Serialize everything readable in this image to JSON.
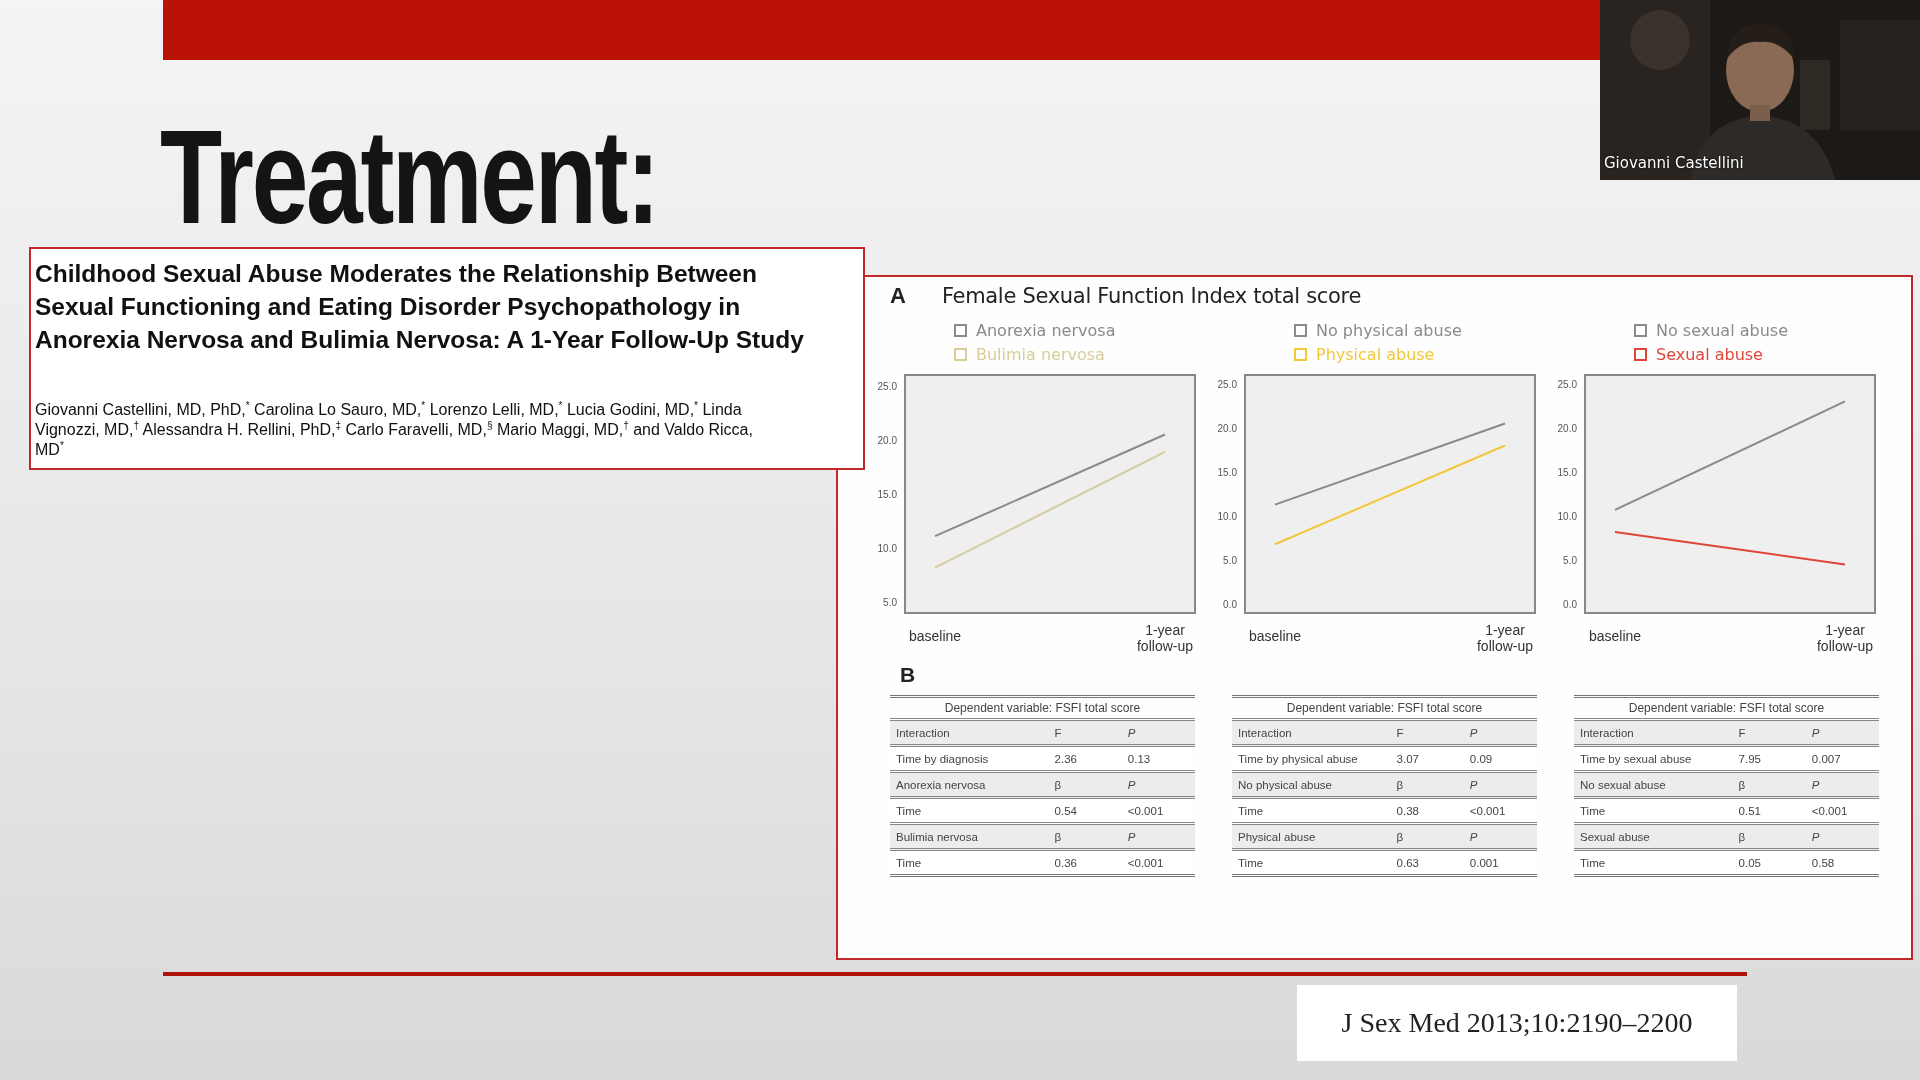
{
  "slide": {
    "title": "Treatment:"
  },
  "paper": {
    "title": "Childhood Sexual Abuse Moderates the Relationship Between Sexual Functioning and Eating Disorder Psychopathology in Anorexia Nervosa and Bulimia Nervosa: A 1-Year Follow-Up Study",
    "authors": "Giovanni Castellini, MD, PhD,$^{*}$ Carolina Lo Sauro, MD,$^{*}$ Lorenzo Lelli, MD,$^{*}$ Lucia Godini, MD,$^{*}$ Linda Vignozzi, MD,$^{†}$ Alessandra H. Rellini, PhD,$^{‡}$ Carlo Faravelli, MD,$^{§}$ Mario Maggi, MD,$^{†}$ and Valdo Ricca, MD$^{*}$"
  },
  "figure": {
    "panel_a_label": "A",
    "panel_a_title": "Female Sexual Function Index total score",
    "panel_b_label": "B",
    "charts": [
      {
        "chart_data": {
          "type": "line",
          "legend": true,
          "categories": [
            "baseline",
            "1-year follow-up"
          ],
          "ylim": [
            4,
            26
          ],
          "yticks": [
            {
              "value": 5,
              "label": "5.0"
            },
            {
              "value": 10,
              "label": "10.0"
            },
            {
              "value": 15,
              "label": "15.0"
            },
            {
              "value": 20,
              "label": "20.0"
            },
            {
              "value": 25,
              "label": "25.0"
            }
          ],
          "series": [
            {
              "name": "Anorexia nervosa",
              "color": "#8a8a8a",
              "values": [
                11.1,
                20.5
              ]
            },
            {
              "name": "Bulimia nervosa",
              "color": "#d8cc9a",
              "values": [
                8.2,
                18.9
              ]
            }
          ]
        }
      },
      {
        "chart_data": {
          "type": "line",
          "legend": true,
          "categories": [
            "baseline",
            "1-year follow-up"
          ],
          "ylim": [
            -1,
            26
          ],
          "yticks": [
            {
              "value": 0,
              "label": "0.0"
            },
            {
              "value": 5,
              "label": "5.0"
            },
            {
              "value": 10,
              "label": "10.0"
            },
            {
              "value": 15,
              "label": "15.0"
            },
            {
              "value": 20,
              "label": "20.0"
            },
            {
              "value": 25,
              "label": "25.0"
            }
          ],
          "series": [
            {
              "name": "No physical abuse",
              "color": "#8a8a8a",
              "values": [
                11.3,
                20.5
              ]
            },
            {
              "name": "Physical abuse",
              "color": "#f2c73a",
              "values": [
                6.8,
                18.0
              ]
            }
          ]
        }
      },
      {
        "chart_data": {
          "type": "line",
          "legend": true,
          "categories": [
            "baseline",
            "1-year follow-up"
          ],
          "ylim": [
            -1,
            26
          ],
          "yticks": [
            {
              "value": 0,
              "label": "0.0"
            },
            {
              "value": 5,
              "label": "5.0"
            },
            {
              "value": 10,
              "label": "10.0"
            },
            {
              "value": 15,
              "label": "15.0"
            },
            {
              "value": 20,
              "label": "20.0"
            },
            {
              "value": 25,
              "label": "25.0"
            }
          ],
          "series": [
            {
              "name": "No sexual abuse",
              "color": "#8a8a8a",
              "values": [
                10.7,
                23.0
              ]
            },
            {
              "name": "Sexual abuse",
              "color": "#e0453a",
              "values": [
                8.2,
                4.5
              ]
            }
          ]
        }
      }
    ],
    "tables": [
      {
        "caption": "Dependent variable: FSFI total score",
        "rows": [
          {
            "kind": "header",
            "cells": [
              "Interaction",
              "F",
              "P"
            ]
          },
          {
            "kind": "value",
            "cells": [
              "Time by diagnosis",
              "2.36",
              "0.13"
            ]
          },
          {
            "kind": "header",
            "cells": [
              "Anorexia nervosa",
              "β",
              "P"
            ]
          },
          {
            "kind": "value",
            "cells": [
              "Time",
              "0.54",
              "<0.001"
            ]
          },
          {
            "kind": "header",
            "cells": [
              "Bulimia nervosa",
              "β",
              "P"
            ]
          },
          {
            "kind": "value",
            "cells": [
              "Time",
              "0.36",
              "<0.001"
            ]
          }
        ]
      },
      {
        "caption": "Dependent variable: FSFI total score",
        "rows": [
          {
            "kind": "header",
            "cells": [
              "Interaction",
              "F",
              "P"
            ]
          },
          {
            "kind": "value",
            "cells": [
              "Time by physical abuse",
              "3.07",
              "0.09"
            ]
          },
          {
            "kind": "header",
            "cells": [
              "No physical abuse",
              "β",
              "P"
            ]
          },
          {
            "kind": "value",
            "cells": [
              "Time",
              "0.38",
              "<0.001"
            ]
          },
          {
            "kind": "header",
            "cells": [
              "Physical abuse",
              "β",
              "P"
            ]
          },
          {
            "kind": "value",
            "cells": [
              "Time",
              "0.63",
              "0.001"
            ]
          }
        ]
      },
      {
        "caption": "Dependent variable: FSFI total score",
        "rows": [
          {
            "kind": "header",
            "cells": [
              "Interaction",
              "F",
              "P"
            ]
          },
          {
            "kind": "value",
            "cells": [
              "Time by sexual abuse",
              "7.95",
              "0.007"
            ]
          },
          {
            "kind": "header",
            "cells": [
              "No sexual abuse",
              "β",
              "P"
            ]
          },
          {
            "kind": "value",
            "cells": [
              "Time",
              "0.51",
              "<0.001"
            ]
          },
          {
            "kind": "header",
            "cells": [
              "Sexual abuse",
              "β",
              "P"
            ]
          },
          {
            "kind": "value",
            "cells": [
              "Time",
              "0.05",
              "0.58"
            ]
          }
        ]
      }
    ]
  },
  "citation": "J Sex Med 2013;10:2190–2200",
  "video_tile": {
    "participant_name": "Giovanni Castellini",
    "kind": "picture"
  }
}
